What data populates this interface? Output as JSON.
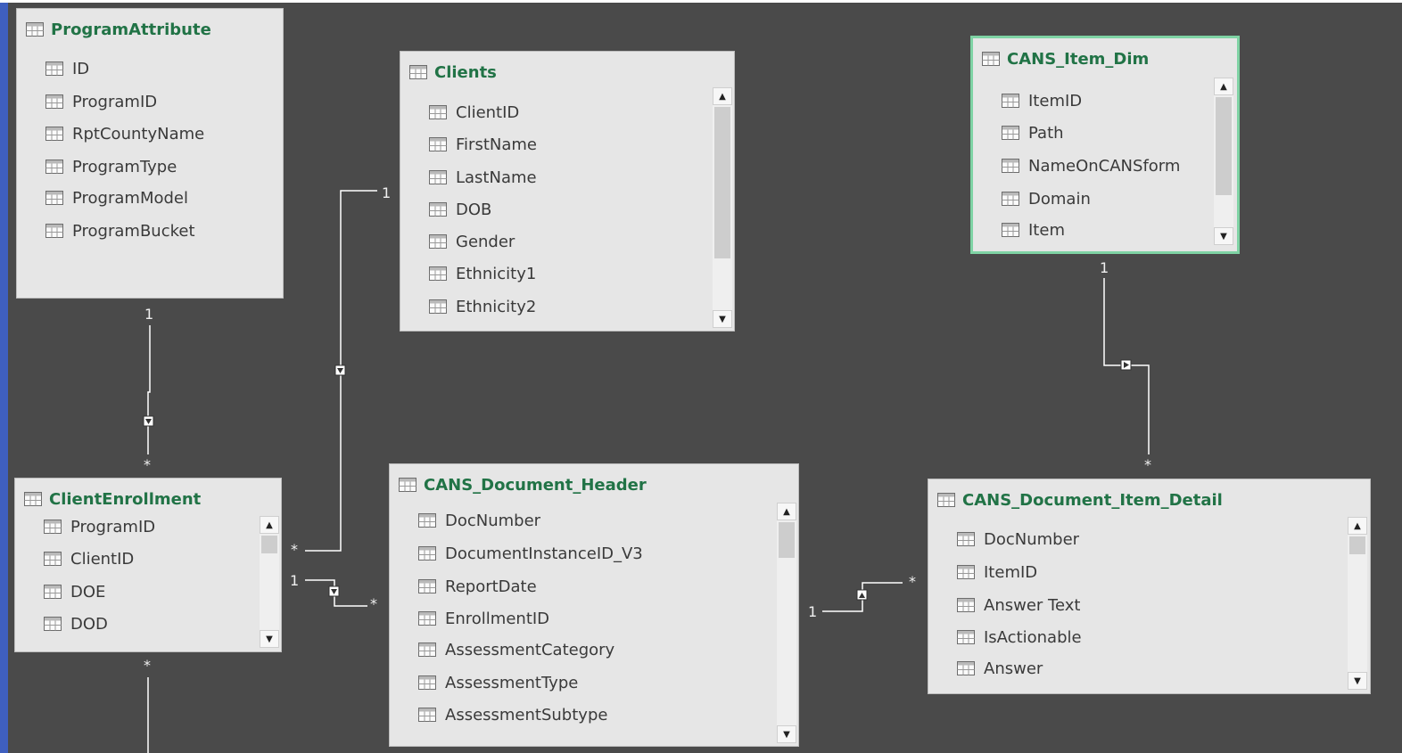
{
  "tables": {
    "program_attribute": {
      "title": "ProgramAttribute",
      "columns": [
        "ID",
        "ProgramID",
        "RptCountyName",
        "ProgramType",
        "ProgramModel",
        "ProgramBucket"
      ]
    },
    "clients": {
      "title": "Clients",
      "columns": [
        "ClientID",
        "FirstName",
        "LastName",
        "DOB",
        "Gender",
        "Ethnicity1",
        "Ethnicity2"
      ]
    },
    "cans_item_dim": {
      "title": "CANS_Item_Dim",
      "columns": [
        "ItemID",
        "Path",
        "NameOnCANSform",
        "Domain",
        "Item"
      ]
    },
    "client_enrollment": {
      "title": "ClientEnrollment",
      "columns": [
        "ProgramID",
        "ClientID",
        "DOE",
        "DOD"
      ]
    },
    "cans_document_header": {
      "title": "CANS_Document_Header",
      "columns": [
        "DocNumber",
        "DocumentInstanceID_V3",
        "ReportDate",
        "EnrollmentID",
        "AssessmentCategory",
        "AssessmentType",
        "AssessmentSubtype"
      ]
    },
    "cans_document_item_detail": {
      "title": "CANS_Document_Item_Detail",
      "columns": [
        "DocNumber",
        "ItemID",
        "Answer Text",
        "IsActionable",
        "Answer"
      ]
    }
  },
  "relationships": [
    {
      "from": "ProgramAttribute",
      "to": "ClientEnrollment",
      "from_card": "1",
      "to_card": "*"
    },
    {
      "from": "Clients",
      "to": "ClientEnrollment",
      "from_card": "1",
      "to_card": "*"
    },
    {
      "from": "ClientEnrollment",
      "to": "CANS_Document_Header",
      "from_card": "1",
      "to_card": "*"
    },
    {
      "from": "CANS_Document_Header",
      "to": "CANS_Document_Item_Detail",
      "from_card": "1",
      "to_card": "*"
    },
    {
      "from": "CANS_Item_Dim",
      "to": "CANS_Document_Item_Detail",
      "from_card": "1",
      "to_card": "*"
    }
  ],
  "icons": {
    "table": "table-icon",
    "column": "column-icon",
    "scroll_up": "scroll-up-arrow",
    "scroll_down": "scroll-down-arrow",
    "filter_direction": "filter-direction-icon"
  },
  "colors": {
    "canvas": "#4a4a4a",
    "table_bg": "#e6e6e6",
    "title": "#217346",
    "selected_border": "#7fd3a4",
    "line": "#ffffff"
  }
}
